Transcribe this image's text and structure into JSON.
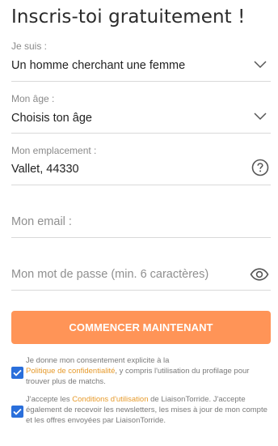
{
  "form": {
    "title": "Inscris-toi gratuitement !",
    "gender": {
      "label": "Je suis :",
      "value": "Un homme cherchant une femme"
    },
    "age": {
      "label": "Mon âge :",
      "value": "Choisis ton âge"
    },
    "location": {
      "label": "Mon emplacement :",
      "value": "Vallet, 44330"
    },
    "email": {
      "placeholder": "Mon email :"
    },
    "password": {
      "placeholder": "Mon mot de passe (min. 6 caractères)"
    },
    "submit_label": "COMMENCER MAINTENANT"
  },
  "consent": {
    "privacy": {
      "checked": true,
      "before": "Je donne mon consentement explicite à la",
      "link": "Politique de confidentialité",
      "after": ", y compris l'utilisation du profilage pour trouver plus de matchs."
    },
    "terms": {
      "checked": true,
      "before": "J'accepte les ",
      "link": "Conditions d'utilisation",
      "after": " de LiaisonTorride. J'accepte également de recevoir les newsletters, les mises à jour de mon compte et les offres envoyées par LiaisonTorride."
    }
  },
  "colors": {
    "accent": "#ff9457",
    "checkbox": "#2a6fdb",
    "link": "#e69a2b"
  },
  "icons": {
    "dropdown": "chevron-down-icon",
    "help": "question-circle-icon",
    "password_visibility": "eye-icon",
    "checkbox": "checkmark-icon"
  }
}
